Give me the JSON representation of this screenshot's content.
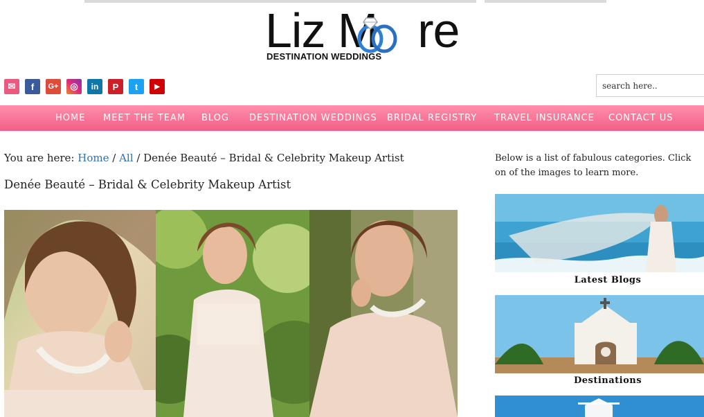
{
  "brand": {
    "name_part1": "Liz M",
    "name_part2": "re",
    "tagline": "DESTINATION WEDDINGS",
    "ring_color": "#2f7fd6"
  },
  "social": [
    {
      "name": "email-icon",
      "glyph": "✉",
      "color": "#ea5a80"
    },
    {
      "name": "facebook-icon",
      "glyph": "f",
      "color": "#3b5a9a"
    },
    {
      "name": "google-plus-icon",
      "glyph": "G+",
      "color": "#dd4b39"
    },
    {
      "name": "instagram-icon",
      "glyph": "◎",
      "color": "#c13584"
    },
    {
      "name": "linkedin-icon",
      "glyph": "in",
      "color": "#0e76a8"
    },
    {
      "name": "pinterest-icon",
      "glyph": "P",
      "color": "#cb2027"
    },
    {
      "name": "twitter-icon",
      "glyph": "t",
      "color": "#1da1f2"
    },
    {
      "name": "youtube-icon",
      "glyph": "▶",
      "color": "#d00000"
    }
  ],
  "search": {
    "placeholder": "search here.."
  },
  "nav": {
    "items": [
      "HOME",
      "MEET THE TEAM",
      "BLOG",
      "DESTINATION WEDDINGS",
      "BRIDAL REGISTRY",
      "TRAVEL INSURANCE",
      "CONTACT US"
    ],
    "color_top": "#ff8fab",
    "color_bottom": "#f25f86"
  },
  "breadcrumb": {
    "prefix": "You are here:",
    "home": "Home",
    "sep": "/",
    "all": "All",
    "current": "Denée Beauté – Bridal & Celebrity Makeup Artist"
  },
  "page": {
    "title": "Denée Beauté – Bridal & Celebrity Makeup Artist"
  },
  "sidebar": {
    "intro": "Below is a list of fabulous categories. Click on of the images to learn more.",
    "cards": [
      {
        "caption": "Latest Blogs"
      },
      {
        "caption": "Destinations"
      }
    ]
  }
}
